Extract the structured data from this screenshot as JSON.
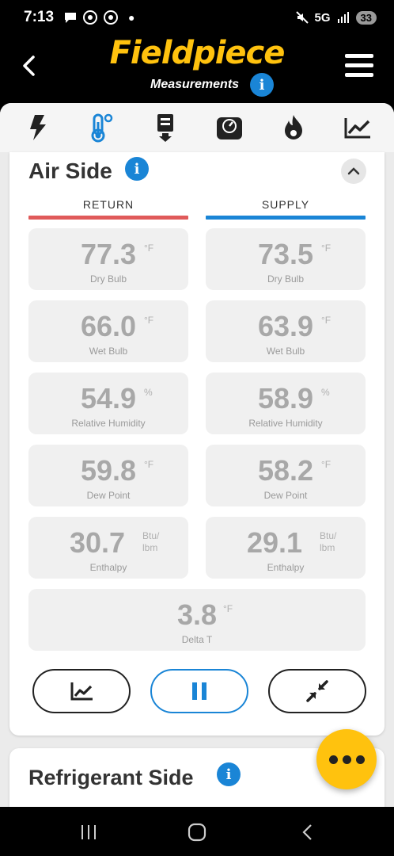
{
  "status_bar": {
    "time": "7:13",
    "network": "5G",
    "battery": "33"
  },
  "header": {
    "brand": "Fieldpiece",
    "subtitle": "Measurements"
  },
  "tabs": [
    {
      "icon": "lightning-icon"
    },
    {
      "icon": "thermometer-icon",
      "active": true
    },
    {
      "icon": "download-device-icon"
    },
    {
      "icon": "gauge-icon"
    },
    {
      "icon": "flame-icon"
    },
    {
      "icon": "trend-chart-icon"
    }
  ],
  "air_side": {
    "title": "Air Side",
    "columns": {
      "return": "RETURN",
      "supply": "SUPPLY"
    },
    "return": {
      "dry_bulb": {
        "value": "77.3",
        "unit": "°F",
        "label": "Dry Bulb"
      },
      "wet_bulb": {
        "value": "66.0",
        "unit": "°F",
        "label": "Wet Bulb"
      },
      "rh": {
        "value": "54.9",
        "unit": "%",
        "label": "Relative Humidity"
      },
      "dew_point": {
        "value": "59.8",
        "unit": "°F",
        "label": "Dew Point"
      },
      "enthalpy": {
        "value": "30.7",
        "unit1": "Btu/",
        "unit2": "lbm",
        "label": "Enthalpy"
      }
    },
    "supply": {
      "dry_bulb": {
        "value": "73.5",
        "unit": "°F",
        "label": "Dry Bulb"
      },
      "wet_bulb": {
        "value": "63.9",
        "unit": "°F",
        "label": "Wet Bulb"
      },
      "rh": {
        "value": "58.9",
        "unit": "%",
        "label": "Relative Humidity"
      },
      "dew_point": {
        "value": "58.2",
        "unit": "°F",
        "label": "Dew Point"
      },
      "enthalpy": {
        "value": "29.1",
        "unit1": "Btu/",
        "unit2": "lbm",
        "label": "Enthalpy"
      }
    },
    "delta_t": {
      "value": "3.8",
      "unit": "°F",
      "label": "Delta T"
    }
  },
  "refrigerant_side": {
    "title": "Refrigerant Side"
  },
  "colors": {
    "brand": "#ffc20e",
    "accent": "#1a85d6",
    "return": "#e05a5a",
    "supply": "#1a85d6"
  }
}
